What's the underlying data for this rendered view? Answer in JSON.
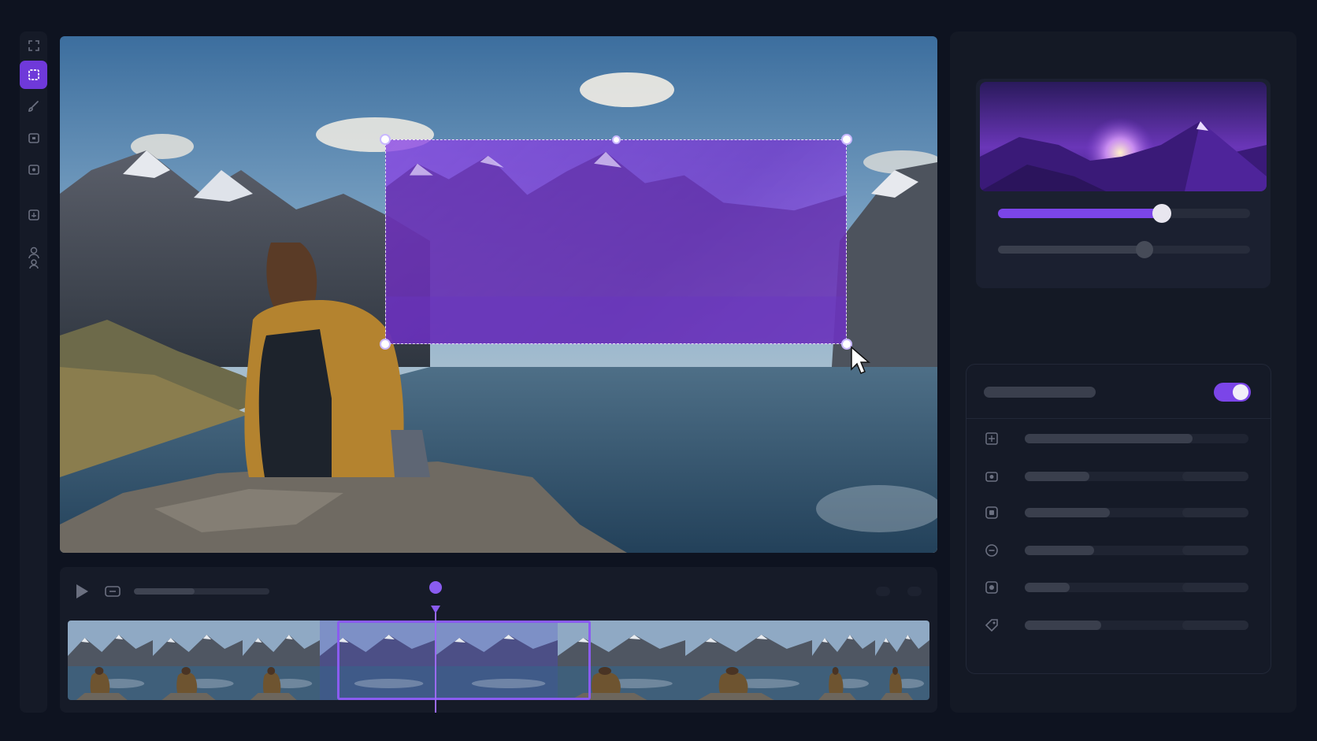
{
  "toolbar": {
    "tools": [
      {
        "name": "expand-icon",
        "active": false
      },
      {
        "name": "select-crop-icon",
        "active": true
      },
      {
        "name": "brush-icon",
        "active": false
      },
      {
        "name": "layer-icon",
        "active": false
      },
      {
        "name": "adjust-icon",
        "active": false
      },
      {
        "name": "stamp-icon",
        "active": false
      },
      {
        "name": "people-icon",
        "active": false
      }
    ]
  },
  "canvas": {
    "selection_tint": "#8a46e6",
    "handle_color": "#ffffff"
  },
  "timeline": {
    "play_icon": "play-icon",
    "loop_icon": "loop-icon",
    "progress": 0.45,
    "frames": 9,
    "selected_frames": [
      3,
      4
    ],
    "accent": "#8a5cf0"
  },
  "right_panel": {
    "preview_sliders": [
      {
        "value": 0.65,
        "color": "#7b45e8"
      },
      {
        "value": 0.58,
        "color": "#3a3f4d"
      }
    ],
    "settings": {
      "toggle_on": true,
      "rows": [
        {
          "icon": "image-plus-icon",
          "value": 0.75
        },
        {
          "icon": "camera-icon",
          "value": 0.29
        },
        {
          "icon": "square-icon",
          "value": 0.38
        },
        {
          "icon": "chat-icon",
          "value": 0.31
        },
        {
          "icon": "badge-icon",
          "value": 0.2
        },
        {
          "icon": "tag-icon",
          "value": 0.34
        }
      ]
    }
  }
}
